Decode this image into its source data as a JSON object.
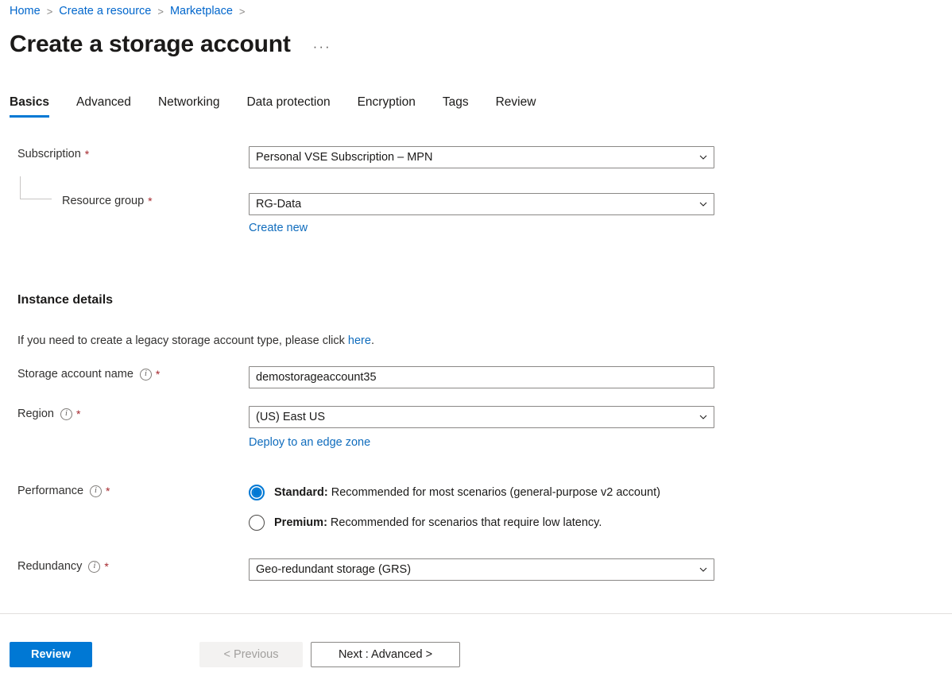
{
  "breadcrumb": {
    "items": [
      "Home",
      "Create a resource",
      "Marketplace"
    ],
    "separator": ">"
  },
  "header": {
    "title": "Create a storage account",
    "ellipsis": "···"
  },
  "tabs": [
    {
      "label": "Basics",
      "active": true
    },
    {
      "label": "Advanced",
      "active": false
    },
    {
      "label": "Networking",
      "active": false
    },
    {
      "label": "Data protection",
      "active": false
    },
    {
      "label": "Encryption",
      "active": false
    },
    {
      "label": "Tags",
      "active": false
    },
    {
      "label": "Review",
      "active": false
    }
  ],
  "form": {
    "subscription": {
      "label": "Subscription",
      "required": "*",
      "value": "Personal VSE Subscription – MPN"
    },
    "resource_group": {
      "label": "Resource group",
      "required": "*",
      "value": "RG-Data",
      "create_new_link": "Create new"
    },
    "instance_details": {
      "heading": "Instance details",
      "helper_prefix": "If you need to create a legacy storage account type, please click ",
      "helper_link": "here",
      "helper_suffix": "."
    },
    "storage_account_name": {
      "label": "Storage account name",
      "info": "i",
      "required": "*",
      "value": "demostorageaccount35"
    },
    "region": {
      "label": "Region",
      "info": "i",
      "required": "*",
      "value": "(US) East US",
      "edge_zone_link": "Deploy to an edge zone"
    },
    "performance": {
      "label": "Performance",
      "info": "i",
      "required": "*",
      "options": [
        {
          "name": "Standard",
          "separator": ":",
          "description": " Recommended for most scenarios (general-purpose v2 account)",
          "selected": true
        },
        {
          "name": "Premium",
          "separator": ":",
          "description": " Recommended for scenarios that require low latency.",
          "selected": false
        }
      ]
    },
    "redundancy": {
      "label": "Redundancy",
      "info": "i",
      "required": "*",
      "value": "Geo-redundant storage (GRS)"
    }
  },
  "footer": {
    "review_label": "Review",
    "previous_label": "< Previous",
    "next_label": "Next : Advanced >"
  },
  "colors": {
    "accent": "#0078d4",
    "link": "#0f6cbd",
    "breadcrumb_link": "#0066cc",
    "required": "#a4262c",
    "border": "#8a8886",
    "divider": "#e1dfdd",
    "disabled_bg": "#f3f2f1",
    "disabled_text": "#a19f9d"
  }
}
